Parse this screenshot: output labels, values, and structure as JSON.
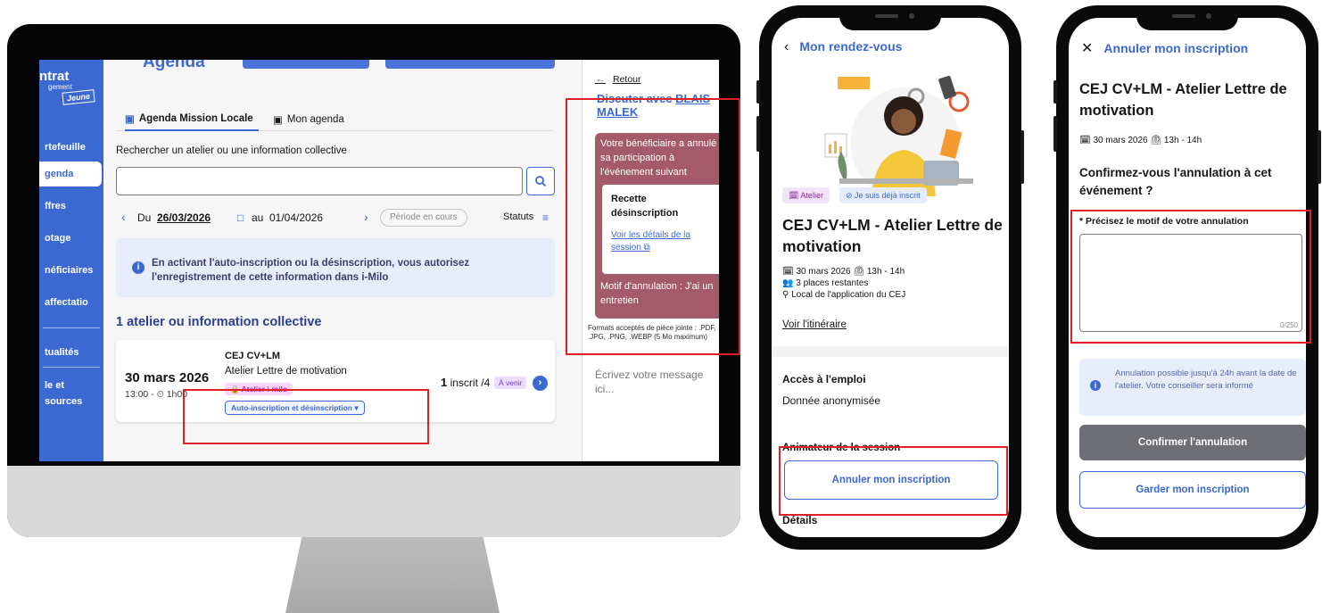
{
  "desktop": {
    "logo": {
      "line1": "ntrat",
      "line2": "gement",
      "line3": "Jeune"
    },
    "sidebar": {
      "items": [
        {
          "label": "rtefeuille"
        },
        {
          "label": "genda",
          "active": true
        },
        {
          "label": "ffres"
        },
        {
          "label": "otage"
        },
        {
          "label": "néficiaires"
        },
        {
          "label": "affectatio"
        },
        {
          "label": "tualités"
        },
        {
          "label": "le et"
        },
        {
          "label": "sources"
        }
      ]
    },
    "page_title": "Agenda",
    "tabs": [
      {
        "label": "Agenda Mission Locale",
        "icon": "calendar-icon",
        "active": true
      },
      {
        "label": "Mon agenda",
        "icon": "calendar-icon",
        "active": false
      }
    ],
    "search": {
      "label": "Rechercher un atelier ou une information collective",
      "value": "",
      "icon": "search-icon"
    },
    "date_filter": {
      "prev": "‹",
      "from_label": "Du",
      "from_date": "26/03/2026",
      "to_label": "au",
      "to_date": "01/04/2026",
      "next": "›",
      "period_button": "Période en cours",
      "status_label": "Statuts"
    },
    "info_banner": "En activant l'auto-inscription ou la désinscription, vous autorisez l'enregistrement de cette information dans i-Milo",
    "results_count": "1 atelier ou information collective",
    "event": {
      "date": "30 mars 2026",
      "time": "13:00 - ⏲ 1h00",
      "name_line1": "CEJ CV+LM",
      "name_line2": "Atelier Lettre de motivation",
      "tag": "🔒 Atelier i-milo",
      "auto_select": "Auto-inscription et désinscription ▾",
      "inscrit_count": "1",
      "inscrit_suffix": " inscrit /4",
      "status_badge": "À venir"
    },
    "chat": {
      "back_label": "Retour",
      "title_prefix": "Discuter avec ",
      "title_name": "BLAIS MALEK",
      "message_intro": "Votre bénéficiaire a annulé sa participation à l'événement suivant",
      "event_title": "Recette désinscription",
      "event_link": "Voir les détails de la session ⧉",
      "motif": "Motif d'annulation : J'ai un entretien",
      "formats": "Formats acceptés de pièce jointe : .PDF, .JPG, .PNG, .WEBP (5 Mo maximum)",
      "input_placeholder": "Écrivez votre message ici..."
    }
  },
  "phone1": {
    "header": "Mon rendez-vous",
    "chip_atelier": "🗓 Atelier",
    "chip_inscrit": "⊘ Je suis déjà inscrit",
    "title": "CEJ CV+LM - Atelier Lettre de motivation",
    "date": "🗓 30 mars 2026   ⏲ 13h - 14h",
    "places": "👥 3 places restantes",
    "location": "⚲ Local de l'application du CEJ",
    "itinerary_link": "Voir l'itinéraire",
    "acces_title": "Accès à l'emploi",
    "acces_value": "Donnée anonymisée",
    "animateur": "Animateur de la session",
    "cancel_button": "Annuler mon inscription",
    "details": "Détails"
  },
  "phone2": {
    "header": "Annuler mon inscription",
    "title": "CEJ CV+LM - Atelier Lettre de motivation",
    "meta": "🗓 30 mars 2026   ⏲ 13h - 14h",
    "question": "Confirmez-vous l'annulation à cet événement ?",
    "reason_label": "* Précisez le motif de votre annulation",
    "reason_value": "",
    "counter": "0/250",
    "info": "Annulation possible jusqu'à 24h avant la date de l'atelier. Votre conseiller sera informé",
    "confirm_button": "Confirmer l'annulation",
    "keep_button": "Garder mon inscription"
  },
  "colors": {
    "brand": "#3b69d1",
    "highlight": "#e01f26",
    "chat_message": "#a35a6a"
  }
}
